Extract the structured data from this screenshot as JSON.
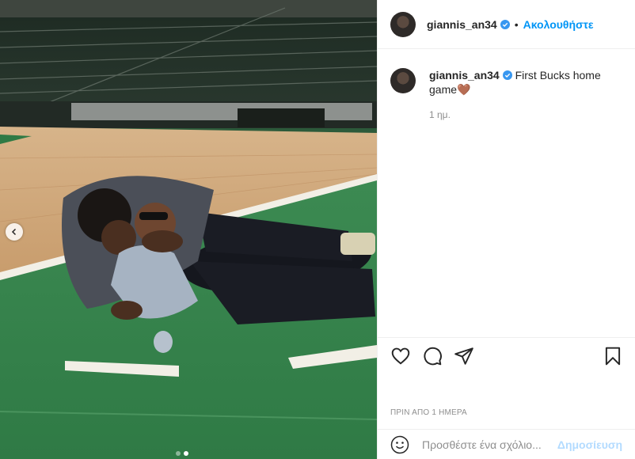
{
  "post": {
    "username": "giannis_an34",
    "follow_label": "Ακολουθήστε",
    "separator": "•",
    "caption_text": "First Bucks home game",
    "caption_emoji": "🤎",
    "relative_time": "1 ημ.",
    "timestamp_caps": "ΠΡΙΝ ΑΠΟ 1 ΗΜΕΡΑ"
  },
  "carousel": {
    "slides_total": 2,
    "active_slide": 2
  },
  "comment": {
    "placeholder": "Προσθέστε ένα σχόλιο...",
    "post_label": "Δημοσίευση"
  },
  "icons": {
    "verified": "verified-badge-icon",
    "like": "heart-icon",
    "comment": "comment-icon",
    "share": "paper-plane-icon",
    "save": "bookmark-icon",
    "emoji": "smiley-icon",
    "prev": "chevron-left-icon"
  },
  "colors": {
    "link": "#0095f6",
    "verified": "#3897f0",
    "muted": "#8e8e8e",
    "post_disabled": "#b3dbff"
  }
}
